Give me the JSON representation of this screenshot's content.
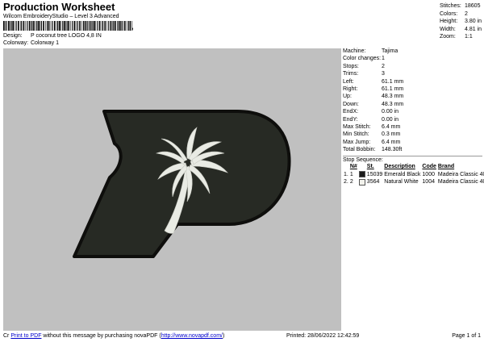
{
  "header": {
    "title": "Production Worksheet",
    "subtitle": "Wilcom EmbroideryStudio – Level 3 Advanced",
    "barcode_suffix": ","
  },
  "design": {
    "label": "Design:",
    "value": "P coconut tree LOGO 4,8 IN"
  },
  "colorway": {
    "label": "Colorway:",
    "value": "Colorway 1"
  },
  "stats": [
    {
      "label": "Stitches:",
      "value": "18605"
    },
    {
      "label": "Colors:",
      "value": "2"
    },
    {
      "label": "Height:",
      "value": "3.80 in"
    },
    {
      "label": "Width:",
      "value": "4.81 in"
    },
    {
      "label": "Zoom:",
      "value": "1:1"
    }
  ],
  "machine_info": [
    {
      "label": "Machine:",
      "value": "Tajima"
    },
    {
      "label": "Color changes:",
      "value": "1"
    },
    {
      "label": "Stops:",
      "value": "2"
    },
    {
      "label": "Trims:",
      "value": "3"
    },
    {
      "label": "Left:",
      "value": "61.1 mm"
    },
    {
      "label": "Right:",
      "value": "61.1 mm"
    },
    {
      "label": "Up:",
      "value": "48.3 mm"
    },
    {
      "label": "Down:",
      "value": "48.3 mm"
    },
    {
      "label": "EndX:",
      "value": "0.00 in"
    },
    {
      "label": "EndY:",
      "value": "0.00 in"
    },
    {
      "label": "Max Stitch:",
      "value": "6.4 mm"
    },
    {
      "label": "Min Stitch:",
      "value": "0.3 mm"
    },
    {
      "label": "Max Jump:",
      "value": "6.4 mm"
    },
    {
      "label": "Total Bobbin:",
      "value": "148.30ft"
    }
  ],
  "stop_sequence": {
    "title": "Stop Sequence:",
    "headers": {
      "n": "N#",
      "st": "St.",
      "description": "Description",
      "code": "Code",
      "brand": "Brand"
    },
    "rows": [
      {
        "stop": "1.",
        "n": "1",
        "color": "#1a1a1a",
        "st": "15039",
        "description": "Emerald Black",
        "code": "1000",
        "brand": "Madeira Classic 40"
      },
      {
        "stop": "2.",
        "n": "2",
        "color": "#f2f2ec",
        "st": "3564",
        "description": "Natural White",
        "code": "1004",
        "brand": "Madeira Classic 40"
      }
    ]
  },
  "footer": {
    "prefix": "Cr",
    "link_text": "Print to PDF",
    "middle": " without this message by purchasing novaPDF (",
    "url_text": "http://www.novapdf.com/",
    "suffix": ")",
    "printed": "Printed: 28/06/2022 12:42:59",
    "page": "Page 1 of 1"
  },
  "colors": {
    "canvas": "#c0c0c0",
    "letter_fill": "#272a24",
    "letter_edge": "#0e0e0c",
    "palm": "#e9ebe4"
  }
}
